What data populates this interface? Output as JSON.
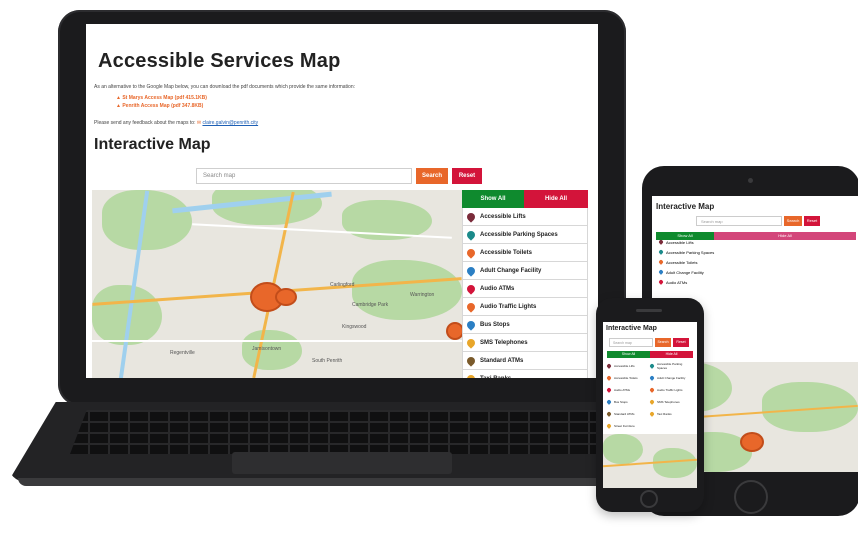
{
  "page": {
    "title": "Accessible Services Map",
    "intro": "As an alternative to the Google Map below, you can download the pdf documents which provide the same information:",
    "pdfs": [
      "St Marys Access Map (pdf 415.1KB)",
      "Penrith Access Map (pdf 347.8KB)"
    ],
    "feedback_text": "Please send any feedback about the maps to:",
    "feedback_email": "claire.galvin@penrith.city",
    "section_title": "Interactive Map"
  },
  "search": {
    "placeholder": "Search map",
    "search_label": "Search",
    "reset_label": "Reset"
  },
  "panel": {
    "show_all": "Show All",
    "hide_all": "Hide All",
    "items": [
      {
        "label": "Accessible Lifts",
        "color": "#7a2b3a"
      },
      {
        "label": "Accessible Parking Spaces",
        "color": "#1b8a8a"
      },
      {
        "label": "Accessible Toilets",
        "color": "#e8672a"
      },
      {
        "label": "Adult Change Facility",
        "color": "#2b7fc4"
      },
      {
        "label": "Audio ATMs",
        "color": "#d3143a"
      },
      {
        "label": "Audio Traffic Lights",
        "color": "#e8672a"
      },
      {
        "label": "Bus Stops",
        "color": "#2b7fc4"
      },
      {
        "label": "SMS Telephones",
        "color": "#e8a62a"
      },
      {
        "label": "Standard ATMs",
        "color": "#7a5a2b"
      },
      {
        "label": "Taxi Ranks",
        "color": "#e8a62a"
      }
    ]
  },
  "map_labels": [
    "Carlingford",
    "Cambridge Park",
    "Warrington",
    "Kingswood",
    "Regentville",
    "Jamisontown",
    "South Penrith"
  ],
  "tablet": {
    "title": "Interactive Map",
    "items": [
      "Accessible Lifts",
      "Accessible Parking Spaces",
      "Accessible Toilets",
      "Adult Change Facility",
      "Audio ATMs"
    ]
  },
  "phone": {
    "title": "Interactive Map",
    "items": [
      [
        "Accessible Lifts",
        "Accessible Parking Spaces"
      ],
      [
        "Accessible Toilets",
        "Adult Change Facility"
      ],
      [
        "Audio ATMs",
        "Audio Traffic Lights"
      ],
      [
        "Bus Stops",
        "SMS Telephones"
      ],
      [
        "Standard ATMs",
        "Taxi Ranks"
      ],
      [
        "Street Furniture",
        ""
      ]
    ]
  },
  "colors": {
    "orange": "#e8672a",
    "red": "#d3143a",
    "green": "#0f8a2e"
  }
}
